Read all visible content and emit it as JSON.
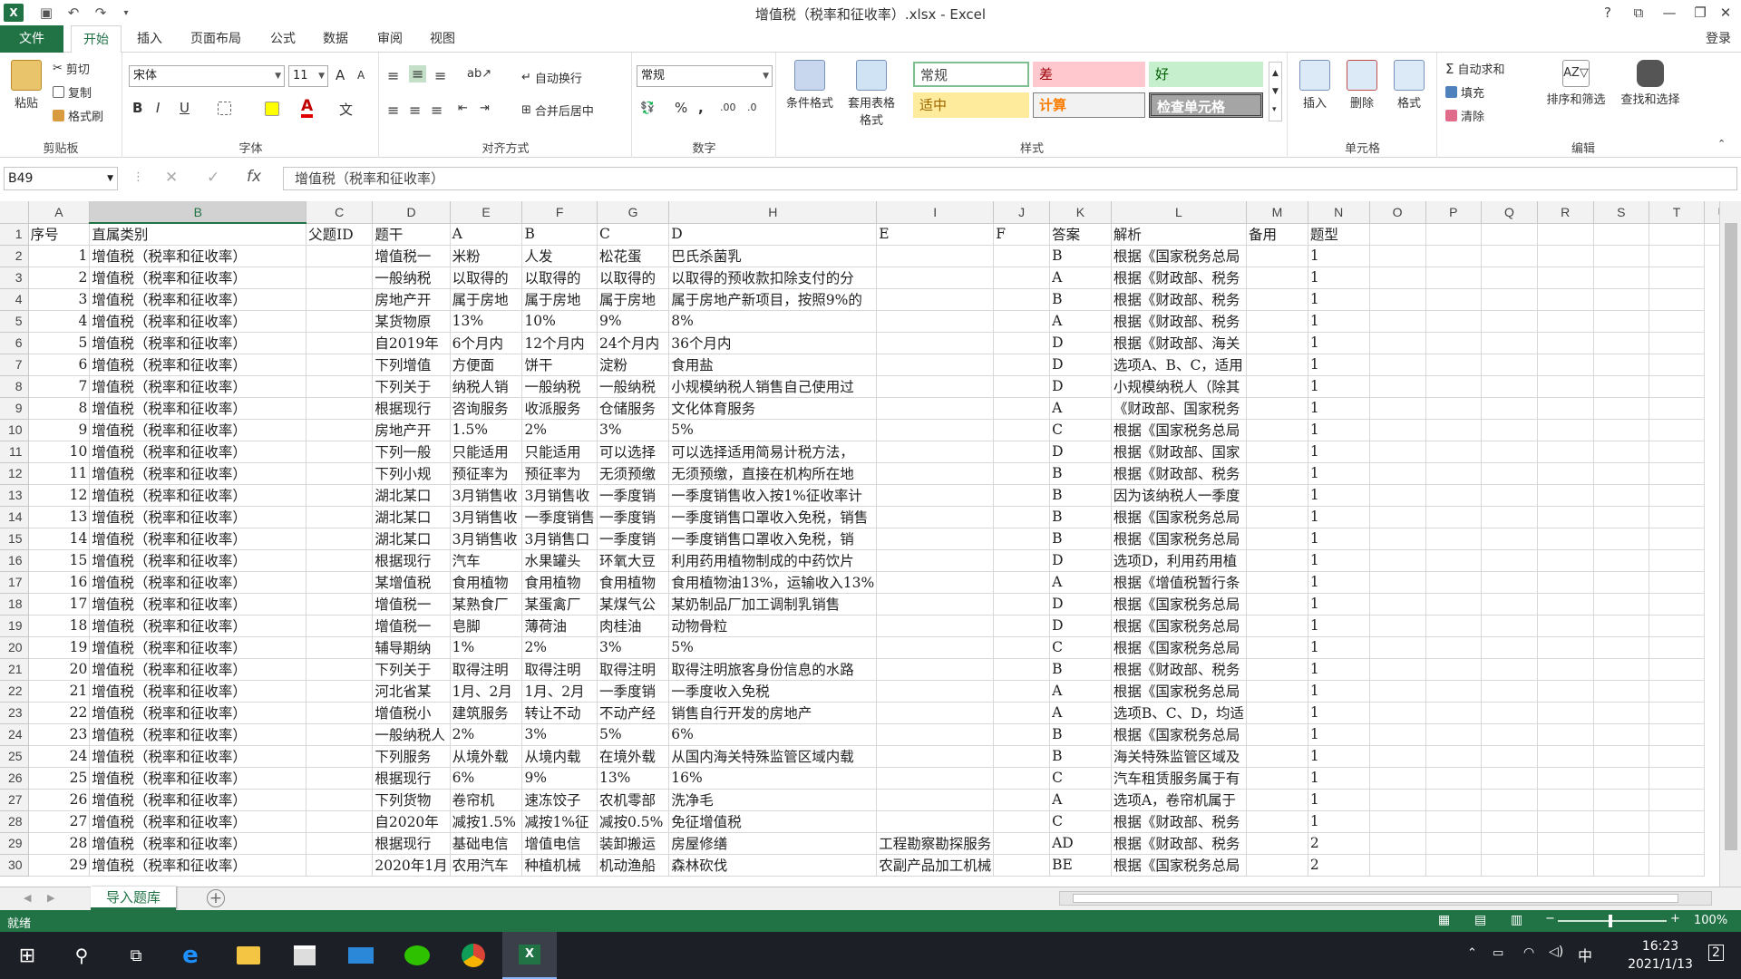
{
  "window": {
    "title": "增值税（税率和征收率）.xlsx - Excel",
    "help": "?",
    "login": "登录"
  },
  "tabs": [
    "文件",
    "开始",
    "插入",
    "页面布局",
    "公式",
    "数据",
    "审阅",
    "视图"
  ],
  "ribbon": {
    "clipboard": {
      "paste": "粘贴",
      "cut": "剪切",
      "copy": "复制",
      "format_painter": "格式刷",
      "label": "剪贴板"
    },
    "font": {
      "name": "宋体",
      "size": "11",
      "grow": "A",
      "shrink": "A",
      "bold": "B",
      "italic": "I",
      "underline": "U",
      "label": "字体"
    },
    "alignment": {
      "wrap": "自动换行",
      "merge": "合并后居中",
      "label": "对齐方式"
    },
    "number": {
      "format": "常规",
      "percent": "%",
      "comma": ",",
      "label": "数字"
    },
    "styles": {
      "conditional": "条件格式",
      "table_format": "套用表格格式",
      "normal": "常规",
      "bad": "差",
      "good": "好",
      "neutral": "适中",
      "calc": "计算",
      "check": "检查单元格",
      "label": "样式"
    },
    "cells": {
      "insert": "插入",
      "delete": "删除",
      "format": "格式",
      "label": "单元格"
    },
    "editing": {
      "autosum": "自动求和",
      "fill": "填充",
      "clear": "清除",
      "sort": "排序和筛选",
      "find": "查找和选择",
      "label": "编辑"
    }
  },
  "formula_bar": {
    "cell_ref": "B49",
    "content": "增值税（税率和征收率）"
  },
  "columns": [
    "A",
    "B",
    "C",
    "D",
    "E",
    "F",
    "G",
    "H",
    "I",
    "J",
    "K",
    "L",
    "M",
    "N",
    "O",
    "P",
    "Q",
    "R",
    "S",
    "T",
    "U"
  ],
  "rows": [
    [
      "1",
      "序号",
      "直属类别",
      "父题ID",
      "题干",
      "A",
      "B",
      "C",
      "D",
      "E",
      "F",
      "答案",
      "解析",
      "备用",
      "题型",
      "",
      "",
      "",
      "",
      "",
      "",
      ""
    ],
    [
      "2",
      "1",
      "增值税（税率和征收率）",
      "",
      "增值税一",
      "米粉",
      "人发",
      "松花蛋",
      "巴氏杀菌乳",
      "",
      "",
      "B",
      "根据《国家税务总局",
      "",
      "1",
      "",
      "",
      "",
      "",
      "",
      ""
    ],
    [
      "3",
      "2",
      "增值税（税率和征收率）",
      "",
      "一般纳税",
      "以取得的",
      "以取得的",
      "以取得的",
      "以取得的预收款扣除支付的分",
      "",
      "",
      "A",
      "根据《财政部、税务",
      "",
      "1",
      "",
      "",
      "",
      "",
      "",
      ""
    ],
    [
      "4",
      "3",
      "增值税（税率和征收率）",
      "",
      "房地产开",
      "属于房地",
      "属于房地",
      "属于房地",
      "属于房地产新项目，按照9%的",
      "",
      "",
      "B",
      "根据《财政部、税务",
      "",
      "1",
      "",
      "",
      "",
      "",
      "",
      ""
    ],
    [
      "5",
      "4",
      "增值税（税率和征收率）",
      "",
      "某货物原",
      "13%",
      "10%",
      "9%",
      "8%",
      "",
      "",
      "A",
      "根据《财政部、税务",
      "",
      "1",
      "",
      "",
      "",
      "",
      "",
      ""
    ],
    [
      "6",
      "5",
      "增值税（税率和征收率）",
      "",
      "自2019年",
      "6个月内",
      "12个月内",
      "24个月内",
      "36个月内",
      "",
      "",
      "D",
      "根据《财政部、海关",
      "",
      "1",
      "",
      "",
      "",
      "",
      "",
      ""
    ],
    [
      "7",
      "6",
      "增值税（税率和征收率）",
      "",
      "下列增值",
      "方便面",
      "饼干",
      "淀粉",
      "食用盐",
      "",
      "",
      "D",
      "选项A、B、C，适用",
      "",
      "1",
      "",
      "",
      "",
      "",
      "",
      ""
    ],
    [
      "8",
      "7",
      "增值税（税率和征收率）",
      "",
      "下列关于",
      "纳税人销",
      "一般纳税",
      "一般纳税",
      "小规模纳税人销售自己使用过",
      "",
      "",
      "D",
      "小规模纳税人（除其",
      "",
      "1",
      "",
      "",
      "",
      "",
      "",
      ""
    ],
    [
      "9",
      "8",
      "增值税（税率和征收率）",
      "",
      "根据现行",
      "咨询服务",
      "收派服务",
      "仓储服务",
      "文化体育服务",
      "",
      "",
      "A",
      "《财政部、国家税务",
      "",
      "1",
      "",
      "",
      "",
      "",
      "",
      ""
    ],
    [
      "10",
      "9",
      "增值税（税率和征收率）",
      "",
      "房地产开",
      "1.5%",
      "2%",
      "3%",
      "5%",
      "",
      "",
      "C",
      "根据《国家税务总局",
      "",
      "1",
      "",
      "",
      "",
      "",
      "",
      ""
    ],
    [
      "11",
      "10",
      "增值税（税率和征收率）",
      "",
      "下列一般",
      "只能适用",
      "只能适用",
      "可以选择",
      "可以选择适用简易计税方法，",
      "",
      "",
      "D",
      "根据《财政部、国家",
      "",
      "1",
      "",
      "",
      "",
      "",
      "",
      ""
    ],
    [
      "12",
      "11",
      "增值税（税率和征收率）",
      "",
      "下列小规",
      "预征率为",
      "预征率为",
      "无须预缴",
      "无须预缴，直接在机构所在地",
      "",
      "",
      "B",
      "根据《财政部、税务",
      "",
      "1",
      "",
      "",
      "",
      "",
      "",
      ""
    ],
    [
      "13",
      "12",
      "增值税（税率和征收率）",
      "",
      "湖北某口",
      "3月销售收",
      "3月销售收",
      "一季度销",
      "一季度销售收入按1%征收率计",
      "",
      "",
      "B",
      "因为该纳税人一季度",
      "",
      "1",
      "",
      "",
      "",
      "",
      "",
      ""
    ],
    [
      "14",
      "13",
      "增值税（税率和征收率）",
      "",
      "湖北某口",
      "3月销售收",
      "一季度销售",
      "一季度销",
      "一季度销售口罩收入免税，销售",
      "",
      "",
      "B",
      "根据《国家税务总局",
      "",
      "1",
      "",
      "",
      "",
      "",
      "",
      ""
    ],
    [
      "15",
      "14",
      "增值税（税率和征收率）",
      "",
      "湖北某口",
      "3月销售收",
      "3月销售口",
      "一季度销",
      "一季度销售口罩收入免税，销",
      "",
      "",
      "B",
      "根据《国家税务总局",
      "",
      "1",
      "",
      "",
      "",
      "",
      "",
      ""
    ],
    [
      "16",
      "15",
      "增值税（税率和征收率）",
      "",
      "根据现行",
      "汽车",
      "水果罐头",
      "环氧大豆",
      "利用药用植物制成的中药饮片",
      "",
      "",
      "D",
      "选项D，利用药用植",
      "",
      "1",
      "",
      "",
      "",
      "",
      "",
      ""
    ],
    [
      "17",
      "16",
      "增值税（税率和征收率）",
      "",
      "某增值税",
      "食用植物",
      "食用植物",
      "食用植物",
      "食用植物油13%，运输收入13%",
      "",
      "",
      "A",
      "根据《增值税暂行条",
      "",
      "1",
      "",
      "",
      "",
      "",
      "",
      ""
    ],
    [
      "18",
      "17",
      "增值税（税率和征收率）",
      "",
      "增值税一",
      "某熟食厂",
      "某蛋禽厂",
      "某煤气公",
      "某奶制品厂加工调制乳销售",
      "",
      "",
      "D",
      "根据《国家税务总局",
      "",
      "1",
      "",
      "",
      "",
      "",
      "",
      ""
    ],
    [
      "19",
      "18",
      "增值税（税率和征收率）",
      "",
      "增值税一",
      "皂脚",
      "薄荷油",
      "肉桂油",
      "动物骨粒",
      "",
      "",
      "D",
      "根据《国家税务总局",
      "",
      "1",
      "",
      "",
      "",
      "",
      "",
      ""
    ],
    [
      "20",
      "19",
      "增值税（税率和征收率）",
      "",
      "辅导期纳",
      "1%",
      "2%",
      "3%",
      "5%",
      "",
      "",
      "C",
      "根据《国家税务总局",
      "",
      "1",
      "",
      "",
      "",
      "",
      "",
      ""
    ],
    [
      "21",
      "20",
      "增值税（税率和征收率）",
      "",
      "下列关于",
      "取得注明",
      "取得注明",
      "取得注明",
      "取得注明旅客身份信息的水路",
      "",
      "",
      "B",
      "根据《财政部、税务",
      "",
      "1",
      "",
      "",
      "",
      "",
      "",
      ""
    ],
    [
      "22",
      "21",
      "增值税（税率和征收率）",
      "",
      "河北省某",
      "1月、2月",
      "1月、2月",
      "一季度销",
      "一季度收入免税",
      "",
      "",
      "A",
      "根据《国家税务总局",
      "",
      "1",
      "",
      "",
      "",
      "",
      "",
      ""
    ],
    [
      "23",
      "22",
      "增值税（税率和征收率）",
      "",
      "增值税小",
      "建筑服务",
      "转让不动",
      "不动产经",
      "销售自行开发的房地产",
      "",
      "",
      "A",
      "选项B、C、D，均适",
      "",
      "1",
      "",
      "",
      "",
      "",
      "",
      ""
    ],
    [
      "24",
      "23",
      "增值税（税率和征收率）",
      "",
      "一般纳税人",
      "2%",
      "3%",
      "5%",
      "6%",
      "",
      "",
      "B",
      "根据《国家税务总局",
      "",
      "1",
      "",
      "",
      "",
      "",
      "",
      ""
    ],
    [
      "25",
      "24",
      "增值税（税率和征收率）",
      "",
      "下列服务",
      "从境外载",
      "从境内载",
      "在境外载",
      "从国内海关特殊监管区域内载",
      "",
      "",
      "B",
      "海关特殊监管区域及",
      "",
      "1",
      "",
      "",
      "",
      "",
      "",
      ""
    ],
    [
      "26",
      "25",
      "增值税（税率和征收率）",
      "",
      "根据现行",
      "6%",
      "9%",
      "13%",
      "16%",
      "",
      "",
      "C",
      "汽车租赁服务属于有",
      "",
      "1",
      "",
      "",
      "",
      "",
      "",
      ""
    ],
    [
      "27",
      "26",
      "增值税（税率和征收率）",
      "",
      "下列货物",
      "卷帘机",
      "速冻饺子",
      "农机零部",
      "洗净毛",
      "",
      "",
      "A",
      "选项A，卷帘机属于",
      "",
      "1",
      "",
      "",
      "",
      "",
      "",
      ""
    ],
    [
      "28",
      "27",
      "增值税（税率和征收率）",
      "",
      "自2020年",
      "减按1.5%",
      "减按1%征",
      "减按0.5%",
      "免征增值税",
      "",
      "",
      "C",
      "根据《财政部、税务",
      "",
      "1",
      "",
      "",
      "",
      "",
      "",
      ""
    ],
    [
      "29",
      "28",
      "增值税（税率和征收率）",
      "",
      "根据现行",
      "基础电信",
      "增值电信",
      "装卸搬运",
      "房屋修缮",
      "工程勘察勘探服务",
      "",
      "AD",
      "根据《财政部、税务",
      "",
      "2",
      "",
      "",
      "",
      "",
      "",
      ""
    ],
    [
      "30",
      "29",
      "增值税（税率和征收率）",
      "",
      "2020年1月",
      "农用汽车",
      "种植机械",
      "机动渔船",
      "森林砍伐",
      "农副产品加工机械",
      "",
      "BE",
      "根据《国家税务总局",
      "",
      "2",
      "",
      "",
      "",
      "",
      "",
      ""
    ]
  ],
  "sheet_tabs": [
    "导入题库"
  ],
  "status": {
    "ready": "就绪",
    "zoom": "100%"
  },
  "taskbar": {
    "time": "16:23",
    "date": "2021/1/13",
    "ime": "中",
    "notif": "2"
  },
  "colors": {
    "excel_green": "#217346",
    "taskbar": "#1c1f26"
  }
}
